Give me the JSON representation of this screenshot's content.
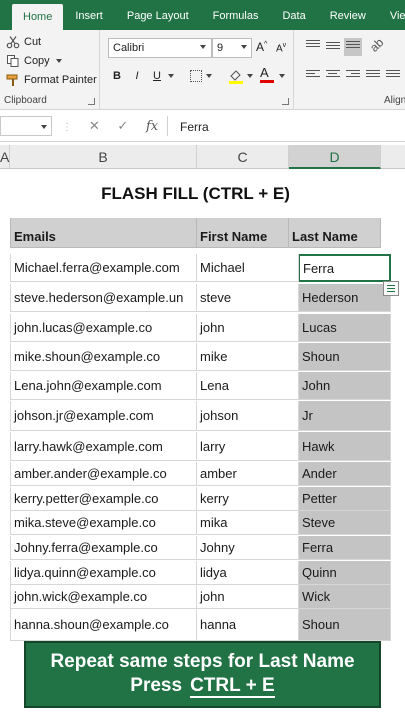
{
  "ribbon": {
    "tabs": [
      "Home",
      "Insert",
      "Page Layout",
      "Formulas",
      "Data",
      "Review",
      "View"
    ],
    "active_tab": "Home",
    "clipboard": {
      "cut": "Cut",
      "copy": "Copy",
      "format_painter": "Format Painter",
      "group_label": "Clipboard"
    },
    "font": {
      "family": "Calibri",
      "size": "9",
      "bold": "B",
      "italic": "I",
      "underline": "U"
    },
    "alignment": {
      "group_label": "Align"
    }
  },
  "formula_bar": {
    "fx": "fx",
    "value": "Ferra"
  },
  "columns": [
    "A",
    "B",
    "C",
    "D"
  ],
  "sheet": {
    "title": "FLASH FILL (CTRL + E)",
    "headers": [
      "Emails",
      "First Name",
      "Last Name"
    ],
    "rows": [
      [
        "Michael.ferra@example.com",
        "Michael",
        "Ferra"
      ],
      [
        "steve.hederson@example.un",
        "steve",
        "Hederson"
      ],
      [
        "john.lucas@example.co",
        "john",
        "Lucas"
      ],
      [
        "mike.shoun@example.co",
        "mike",
        "Shoun"
      ],
      [
        "Lena.john@example.com",
        "Lena",
        "John"
      ],
      [
        "johson.jr@example.com",
        "johson",
        "Jr"
      ],
      [
        "larry.hawk@example.com",
        "larry",
        "Hawk"
      ],
      [
        "amber.ander@example.co",
        "amber",
        "Ander"
      ],
      [
        "kerry.petter@example.co",
        "kerry",
        "Petter"
      ],
      [
        "mika.steve@example.co",
        "mika",
        "Steve"
      ],
      [
        "Johny.ferra@example.co",
        "Johny",
        "Ferra"
      ],
      [
        "lidya.quinn@example.co",
        "lidya",
        "Quinn"
      ],
      [
        "john.wick@example.co",
        "john",
        "Wick"
      ],
      [
        "hanna.shoun@example.co",
        "hanna",
        "Shoun"
      ]
    ]
  },
  "banner": {
    "line1": "Repeat same steps for Last Name",
    "press": "Press",
    "shortcut": "CTRL + E"
  },
  "colors": {
    "excel_green": "#217346",
    "header_gray": "#d0d0d0",
    "fill_gray": "#c4c4c4"
  }
}
